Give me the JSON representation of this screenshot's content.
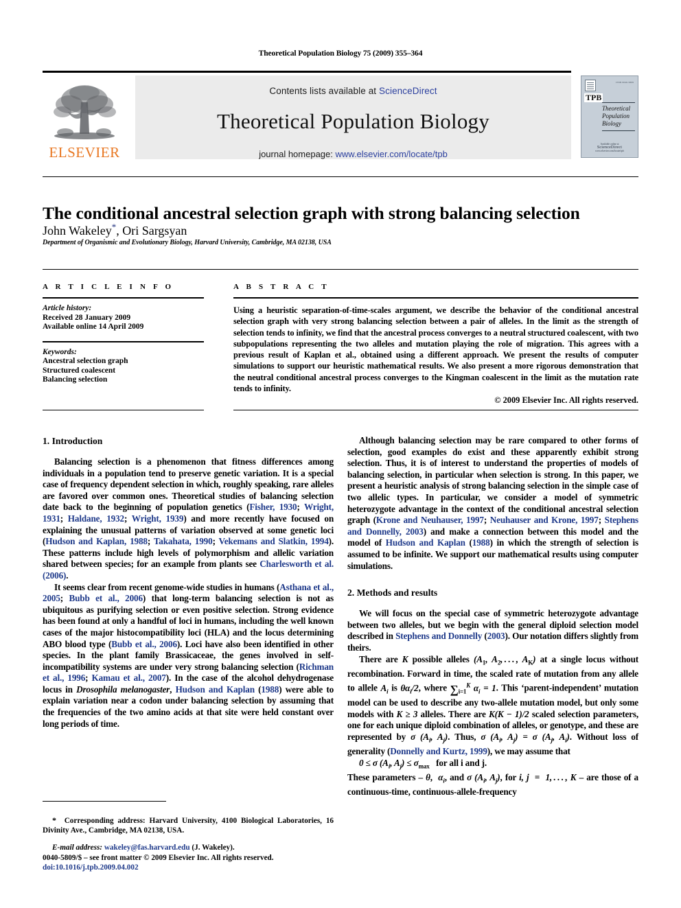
{
  "running_head": "Theoretical Population Biology 75 (2009) 355–364",
  "masthead": {
    "publisher_name": "ELSEVIER",
    "contents_prefix": "Contents lists available at ",
    "contents_link": "ScienceDirect",
    "journal_title": "Theoretical Population Biology",
    "homepage_prefix": "journal homepage: ",
    "homepage_link": "www.elsevier.com/locate/tpb",
    "cover": {
      "issn": "ISSN 0040-5809",
      "abbrev": "TPB",
      "name_line1": "Theoretical",
      "name_line2": "Population",
      "name_line3": "Biology",
      "foot_editor": "Available online at",
      "foot_brand": "ScienceDirect",
      "foot_url": "www.elsevier.com/locate/tpb"
    }
  },
  "title": "The conditional ancestral selection graph with strong balancing selection",
  "authors": "John Wakeley",
  "authors_rest": ", Ori Sargsyan",
  "affiliation": "Department of Organismic and Evolutionary Biology, Harvard University, Cambridge, MA 02138, USA",
  "article_info": {
    "heading": "A R T I C L E    I N F O",
    "history_label": "Article history:",
    "history_lines": [
      "Received 28 January 2009",
      "Available online 14 April 2009"
    ],
    "keywords_label": "Keywords:",
    "keywords": [
      "Ancestral selection graph",
      "Structured coalescent",
      "Balancing selection"
    ]
  },
  "abstract": {
    "heading": "A B S T R A C T",
    "text": "Using a heuristic separation-of-time-scales argument, we describe the behavior of the conditional ancestral selection graph with very strong balancing selection between a pair of alleles. In the limit as the strength of selection tends to infinity, we find that the ancestral process converges to a neutral structured coalescent, with two subpopulations representing the two alleles and mutation playing the role of migration. This agrees with a previous result of Kaplan et al., obtained using a different approach. We present the results of computer simulations to support our heuristic mathematical results. We also present a more rigorous demonstration that the neutral conditional ancestral process converges to the Kingman coalescent in the limit as the mutation rate tends to infinity.",
    "copyright": "© 2009 Elsevier Inc. All rights reserved."
  },
  "sections": {
    "introduction_heading": "1.  Introduction",
    "methods_heading": "2.  Methods and results"
  },
  "body": {
    "intro_p1_a": "Balancing selection is a phenomenon that fitness differences among individuals in a population tend to preserve genetic variation. It is a special case of frequency dependent selection in which, roughly speaking, rare alleles are favored over common ones. Theoretical studies of balancing selection date back to the beginning of population genetics (",
    "intro_p1_ref1": "Fisher, 1930",
    "intro_p1_b": "; ",
    "intro_p1_ref2": "Wright, 1931",
    "intro_p1_c": "; ",
    "intro_p1_ref3": "Haldane, 1932",
    "intro_p1_d": "; ",
    "intro_p1_ref4": "Wright, 1939",
    "intro_p1_e": ") and more recently have focused on explaining the unusual patterns of variation observed at some genetic loci (",
    "intro_p1_ref5": "Hudson and Kaplan, 1988",
    "intro_p1_f": "; ",
    "intro_p1_ref6": "Takahata, 1990",
    "intro_p1_g": "; ",
    "intro_p1_ref7": "Vekemans and Slatkin, 1994",
    "intro_p1_h": "). These patterns include high levels of polymorphism and allelic variation shared between species; for an example from plants see ",
    "intro_p1_ref8": "Charlesworth et al. (2006)",
    "intro_p1_i": ".",
    "intro_p2_a": "It seems clear from recent genome-wide studies in humans (",
    "intro_p2_ref1": "Asthana et al., 2005",
    "intro_p2_b": "; ",
    "intro_p2_ref2": "Bubb et al., 2006",
    "intro_p2_c": ") that long-term balancing selection is not as ubiquitous as purifying selection or even positive selection. Strong evidence has been found at only a handful of loci in humans, including the well known cases of the major histocompatibility loci (HLA) and the locus determining ABO blood type (",
    "intro_p2_ref3": "Bubb et al., 2006",
    "intro_p2_d": "). Loci have also been identified in other species. In the plant family Brassicaceae, the genes involved in self-incompatibility systems are under very strong balancing selection (",
    "intro_p2_ref4": "Richman et al., 1996",
    "intro_p2_e": "; ",
    "intro_p2_ref5": "Kamau et al., 2007",
    "intro_p2_f": "). In the case of the alcohol dehydrogenase locus in ",
    "intro_p2_italic": "Drosophila melanogaster",
    "intro_p2_g": ", ",
    "intro_p2_ref6": "Hudson and Kaplan",
    "intro_p2_h": " (",
    "intro_p2_ref7": "1988",
    "intro_p2_i": ") were able to explain variation near a codon under balancing selection by assuming that the frequencies of the two amino acids at that site were held constant over long periods of time.",
    "right_p1_a": "Although balancing selection may be rare compared to other forms of selection, good examples do exist and these apparently exhibit strong selection. Thus, it is of interest to understand the properties of models of balancing selection, in particular when selection is strong. In this paper, we present a heuristic analysis of strong balancing selection in the simple case of two allelic types. In particular, we consider a model of symmetric heterozygote advantage in the context of the conditional ancestral selection graph (",
    "right_p1_ref1": "Krone and Neuhauser, 1997",
    "right_p1_b": "; ",
    "right_p1_ref2": "Neuhauser and Krone, 1997",
    "right_p1_c": "; ",
    "right_p1_ref3": "Stephens and Donnelly, 2003",
    "right_p1_d": ") and make a connection between this model and the model of ",
    "right_p1_ref4": "Hudson and Kaplan",
    "right_p1_e": " (",
    "right_p1_ref5": "1988",
    "right_p1_f": ") in which the strength of selection is assumed to be infinite. We support our mathematical results using computer simulations.",
    "methods_p1_a": "We will focus on the special case of symmetric heterozygote advantage between two alleles, but we begin with the general diploid selection model described in ",
    "methods_p1_ref1": "Stephens and Donnelly",
    "methods_p1_b": " (",
    "methods_p1_ref2": "2003",
    "methods_p1_c": "). Our notation differs slightly from theirs.",
    "methods_p2_a": "There are ",
    "methods_p2_b": " possible alleles ",
    "methods_p2_c": " at a single locus without recombination. Forward in time, the scaled rate of mutation from any allele to allele ",
    "methods_p2_d": " is ",
    "methods_p2_e": ", where ",
    "methods_p2_f": ". This ‘parent-independent’ mutation model can be used to describe any two-allele mutation model, but only some models with ",
    "methods_p2_g": " alleles. There are ",
    "methods_p2_h": " scaled selection parameters, one for each unique diploid combination of alleles, or genotype, and these are represented by ",
    "methods_p2_i": ". Thus, ",
    "methods_p2_j": ". Without loss of generality (",
    "methods_p2_ref1": "Donnelly and Kurtz, 1999",
    "methods_p2_k": "), we may assume that",
    "equation_tail": "for all i and j.",
    "methods_p3_a": "These parameters – ",
    "methods_p3_b": ", and ",
    "methods_p3_c": ", for ",
    "methods_p3_d": " – are those of a continuous-time, continuous-allele-frequency"
  },
  "footnote": {
    "star": "*",
    "corresponding": "Corresponding address: Harvard University, 4100 Biological Laboratories, 16 Divinity Ave., Cambridge, MA 02138, USA.",
    "email_label": "E-mail address:",
    "email": "wakeley@fas.harvard.edu",
    "email_suffix": "(J. Wakeley)."
  },
  "imprint": {
    "line1": "0040-5809/$ – see front matter © 2009 Elsevier Inc. All rights reserved.",
    "doi": "doi:10.1016/j.tpb.2009.04.002"
  }
}
